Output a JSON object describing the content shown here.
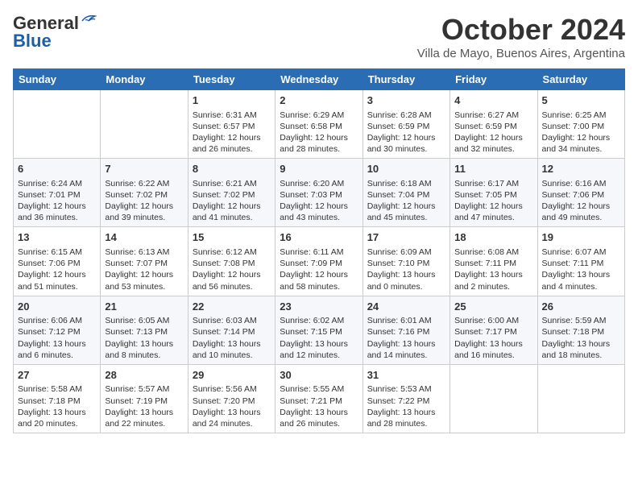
{
  "header": {
    "logo_line1": "General",
    "logo_line2": "Blue",
    "title": "October 2024",
    "subtitle": "Villa de Mayo, Buenos Aires, Argentina"
  },
  "weekdays": [
    "Sunday",
    "Monday",
    "Tuesday",
    "Wednesday",
    "Thursday",
    "Friday",
    "Saturday"
  ],
  "weeks": [
    [
      {
        "day": "",
        "sunrise": "",
        "sunset": "",
        "daylight": ""
      },
      {
        "day": "",
        "sunrise": "",
        "sunset": "",
        "daylight": ""
      },
      {
        "day": "1",
        "sunrise": "Sunrise: 6:31 AM",
        "sunset": "Sunset: 6:57 PM",
        "daylight": "Daylight: 12 hours and 26 minutes."
      },
      {
        "day": "2",
        "sunrise": "Sunrise: 6:29 AM",
        "sunset": "Sunset: 6:58 PM",
        "daylight": "Daylight: 12 hours and 28 minutes."
      },
      {
        "day": "3",
        "sunrise": "Sunrise: 6:28 AM",
        "sunset": "Sunset: 6:59 PM",
        "daylight": "Daylight: 12 hours and 30 minutes."
      },
      {
        "day": "4",
        "sunrise": "Sunrise: 6:27 AM",
        "sunset": "Sunset: 6:59 PM",
        "daylight": "Daylight: 12 hours and 32 minutes."
      },
      {
        "day": "5",
        "sunrise": "Sunrise: 6:25 AM",
        "sunset": "Sunset: 7:00 PM",
        "daylight": "Daylight: 12 hours and 34 minutes."
      }
    ],
    [
      {
        "day": "6",
        "sunrise": "Sunrise: 6:24 AM",
        "sunset": "Sunset: 7:01 PM",
        "daylight": "Daylight: 12 hours and 36 minutes."
      },
      {
        "day": "7",
        "sunrise": "Sunrise: 6:22 AM",
        "sunset": "Sunset: 7:02 PM",
        "daylight": "Daylight: 12 hours and 39 minutes."
      },
      {
        "day": "8",
        "sunrise": "Sunrise: 6:21 AM",
        "sunset": "Sunset: 7:02 PM",
        "daylight": "Daylight: 12 hours and 41 minutes."
      },
      {
        "day": "9",
        "sunrise": "Sunrise: 6:20 AM",
        "sunset": "Sunset: 7:03 PM",
        "daylight": "Daylight: 12 hours and 43 minutes."
      },
      {
        "day": "10",
        "sunrise": "Sunrise: 6:18 AM",
        "sunset": "Sunset: 7:04 PM",
        "daylight": "Daylight: 12 hours and 45 minutes."
      },
      {
        "day": "11",
        "sunrise": "Sunrise: 6:17 AM",
        "sunset": "Sunset: 7:05 PM",
        "daylight": "Daylight: 12 hours and 47 minutes."
      },
      {
        "day": "12",
        "sunrise": "Sunrise: 6:16 AM",
        "sunset": "Sunset: 7:06 PM",
        "daylight": "Daylight: 12 hours and 49 minutes."
      }
    ],
    [
      {
        "day": "13",
        "sunrise": "Sunrise: 6:15 AM",
        "sunset": "Sunset: 7:06 PM",
        "daylight": "Daylight: 12 hours and 51 minutes."
      },
      {
        "day": "14",
        "sunrise": "Sunrise: 6:13 AM",
        "sunset": "Sunset: 7:07 PM",
        "daylight": "Daylight: 12 hours and 53 minutes."
      },
      {
        "day": "15",
        "sunrise": "Sunrise: 6:12 AM",
        "sunset": "Sunset: 7:08 PM",
        "daylight": "Daylight: 12 hours and 56 minutes."
      },
      {
        "day": "16",
        "sunrise": "Sunrise: 6:11 AM",
        "sunset": "Sunset: 7:09 PM",
        "daylight": "Daylight: 12 hours and 58 minutes."
      },
      {
        "day": "17",
        "sunrise": "Sunrise: 6:09 AM",
        "sunset": "Sunset: 7:10 PM",
        "daylight": "Daylight: 13 hours and 0 minutes."
      },
      {
        "day": "18",
        "sunrise": "Sunrise: 6:08 AM",
        "sunset": "Sunset: 7:11 PM",
        "daylight": "Daylight: 13 hours and 2 minutes."
      },
      {
        "day": "19",
        "sunrise": "Sunrise: 6:07 AM",
        "sunset": "Sunset: 7:11 PM",
        "daylight": "Daylight: 13 hours and 4 minutes."
      }
    ],
    [
      {
        "day": "20",
        "sunrise": "Sunrise: 6:06 AM",
        "sunset": "Sunset: 7:12 PM",
        "daylight": "Daylight: 13 hours and 6 minutes."
      },
      {
        "day": "21",
        "sunrise": "Sunrise: 6:05 AM",
        "sunset": "Sunset: 7:13 PM",
        "daylight": "Daylight: 13 hours and 8 minutes."
      },
      {
        "day": "22",
        "sunrise": "Sunrise: 6:03 AM",
        "sunset": "Sunset: 7:14 PM",
        "daylight": "Daylight: 13 hours and 10 minutes."
      },
      {
        "day": "23",
        "sunrise": "Sunrise: 6:02 AM",
        "sunset": "Sunset: 7:15 PM",
        "daylight": "Daylight: 13 hours and 12 minutes."
      },
      {
        "day": "24",
        "sunrise": "Sunrise: 6:01 AM",
        "sunset": "Sunset: 7:16 PM",
        "daylight": "Daylight: 13 hours and 14 minutes."
      },
      {
        "day": "25",
        "sunrise": "Sunrise: 6:00 AM",
        "sunset": "Sunset: 7:17 PM",
        "daylight": "Daylight: 13 hours and 16 minutes."
      },
      {
        "day": "26",
        "sunrise": "Sunrise: 5:59 AM",
        "sunset": "Sunset: 7:18 PM",
        "daylight": "Daylight: 13 hours and 18 minutes."
      }
    ],
    [
      {
        "day": "27",
        "sunrise": "Sunrise: 5:58 AM",
        "sunset": "Sunset: 7:18 PM",
        "daylight": "Daylight: 13 hours and 20 minutes."
      },
      {
        "day": "28",
        "sunrise": "Sunrise: 5:57 AM",
        "sunset": "Sunset: 7:19 PM",
        "daylight": "Daylight: 13 hours and 22 minutes."
      },
      {
        "day": "29",
        "sunrise": "Sunrise: 5:56 AM",
        "sunset": "Sunset: 7:20 PM",
        "daylight": "Daylight: 13 hours and 24 minutes."
      },
      {
        "day": "30",
        "sunrise": "Sunrise: 5:55 AM",
        "sunset": "Sunset: 7:21 PM",
        "daylight": "Daylight: 13 hours and 26 minutes."
      },
      {
        "day": "31",
        "sunrise": "Sunrise: 5:53 AM",
        "sunset": "Sunset: 7:22 PM",
        "daylight": "Daylight: 13 hours and 28 minutes."
      },
      {
        "day": "",
        "sunrise": "",
        "sunset": "",
        "daylight": ""
      },
      {
        "day": "",
        "sunrise": "",
        "sunset": "",
        "daylight": ""
      }
    ]
  ]
}
